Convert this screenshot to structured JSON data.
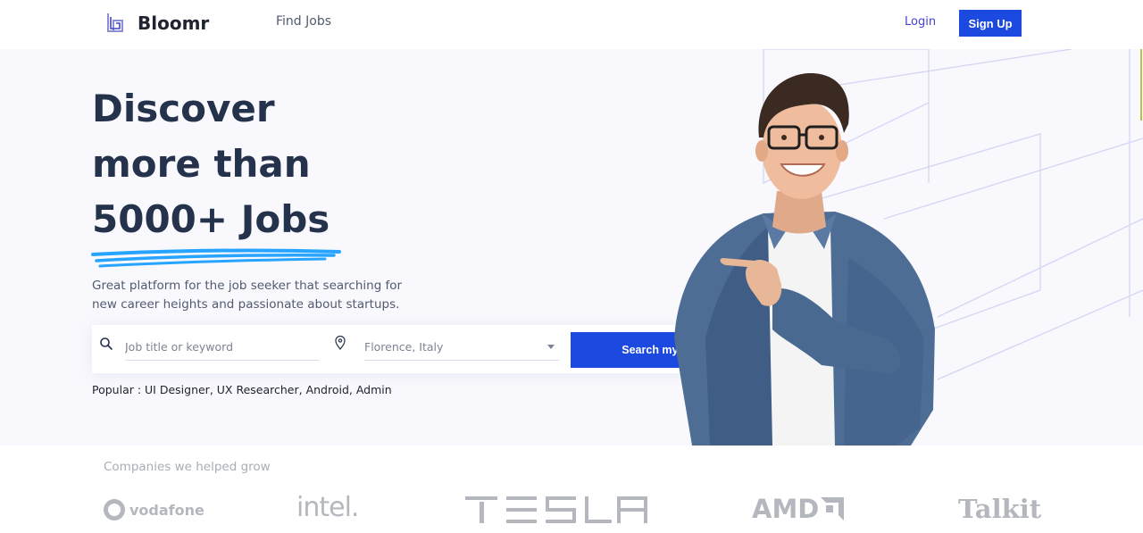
{
  "header": {
    "brand": "Bloomr",
    "nav_find_jobs": "Find Jobs",
    "login": "Login",
    "sign_up": "Sign Up"
  },
  "hero": {
    "title_line1": "Discover",
    "title_line2": "more than",
    "title_line3": "5000+ Jobs",
    "subtitle": "Great platform for the job seeker that searching for new career heights and passionate about startups.",
    "search": {
      "keyword_placeholder": "Job title or keyword",
      "location_value": "Florence, Italy",
      "button_label": "Search my job"
    },
    "popular": "Popular : UI Designer, UX Researcher, Android, Admin"
  },
  "companies": {
    "label": "Companies we helped grow",
    "logos": [
      "vodafone",
      "intel.",
      "TESLA",
      "AMD",
      "Talkit"
    ]
  },
  "colors": {
    "primary": "#1c49e0",
    "heading": "#25324b",
    "accent_underline": "#26a4ff",
    "hero_bg": "#f8f8fd"
  }
}
